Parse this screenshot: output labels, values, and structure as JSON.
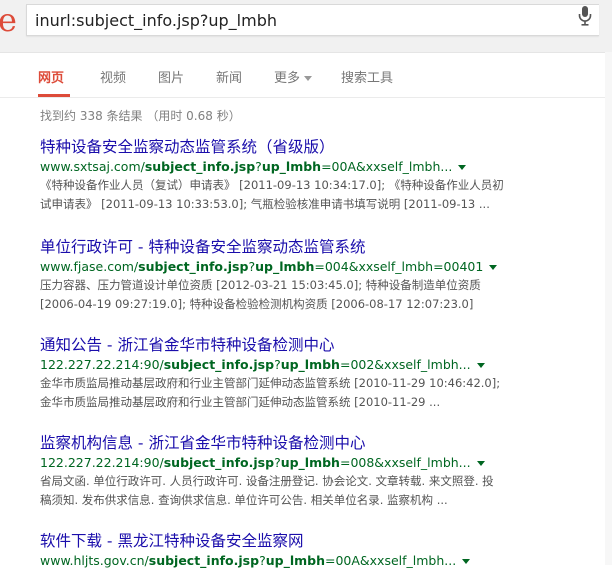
{
  "search": {
    "query": "inurl:subject_info.jsp?up_lmbh",
    "logo_fragment": "e"
  },
  "tabs": [
    {
      "label": "网页",
      "active": true
    },
    {
      "label": "视频"
    },
    {
      "label": "图片"
    },
    {
      "label": "新闻"
    },
    {
      "label": "更多"
    },
    {
      "label": "搜索工具"
    }
  ],
  "stats": "找到约 338 条结果 （用时 0.68 秒）",
  "results": [
    {
      "title": "特种设备安全监察动态监管系统（省级版）",
      "url_pre": "www.sxtsaj.com/",
      "url_bold": "subject_info.jsp",
      "url_mid": "?",
      "url_bold2": "up_lmbh",
      "url_post": "=00A&xxself_lmbh...",
      "snippet": [
        "《特种设备作业人员（复试）申请表》 [2011-09-13 10:34:17.0]; 《特种设备作业人员初",
        "试申请表》 [2011-09-13 10:33:53.0]; 气瓶检验核准申请书填写说明 [2011-09-13 ..."
      ]
    },
    {
      "title": "单位行政许可 - 特种设备安全监察动态监管系统",
      "url_pre": "www.fjase.com/",
      "url_bold": "subject_info.jsp",
      "url_mid": "?",
      "url_bold2": "up_lmbh",
      "url_post": "=004&xxself_lmbh=00401",
      "snippet": [
        "压力容器、压力管道设计单位资质 [2012-03-21 15:03:45.0]; 特种设备制造单位资质",
        "[2006-04-19 09:27:19.0]; 特种设备检验检测机构资质 [2006-08-17 12:07:23.0]"
      ]
    },
    {
      "title": "通知公告 - 浙江省金华市特种设备检测中心",
      "url_pre": "122.227.22.214:90/",
      "url_bold": "subject_info.jsp",
      "url_mid": "?",
      "url_bold2": "up_lmbh",
      "url_post": "=002&xxself_lmbh...",
      "snippet": [
        "金华市质监局推动基层政府和行业主管部门延伸动态监管系统 [2010-11-29 10:46:42.0];",
        "金华市质监局推动基层政府和行业主管部门延伸动态监管系统 [2010-11-29 ..."
      ]
    },
    {
      "title": "监察机构信息 - 浙江省金华市特种设备检测中心",
      "url_pre": "122.227.22.214:90/",
      "url_bold": "subject_info.jsp",
      "url_mid": "?",
      "url_bold2": "up_lmbh",
      "url_post": "=008&xxself_lmbh...",
      "snippet": [
        "省局文函. 单位行政许可. 人员行政许可. 设备注册登记. 协会论文. 文章转载. 来文照登. 投",
        "稿须知. 发布供求信息. 查询供求信息. 单位许可公告. 相关单位名录. 监察机构 ..."
      ]
    },
    {
      "title": "软件下载 - 黑龙江特种设备安全监察网",
      "url_pre": "www.hljts.gov.cn/",
      "url_bold": "subject_info.jsp",
      "url_mid": "?",
      "url_bold2": "up_lmbh",
      "url_post": "=00A&xxself_lmbh...",
      "snippet": []
    }
  ],
  "colors": {
    "accent": "#dd4b39",
    "link": "#1a0dab",
    "url": "#006621",
    "snippet": "#545454"
  }
}
